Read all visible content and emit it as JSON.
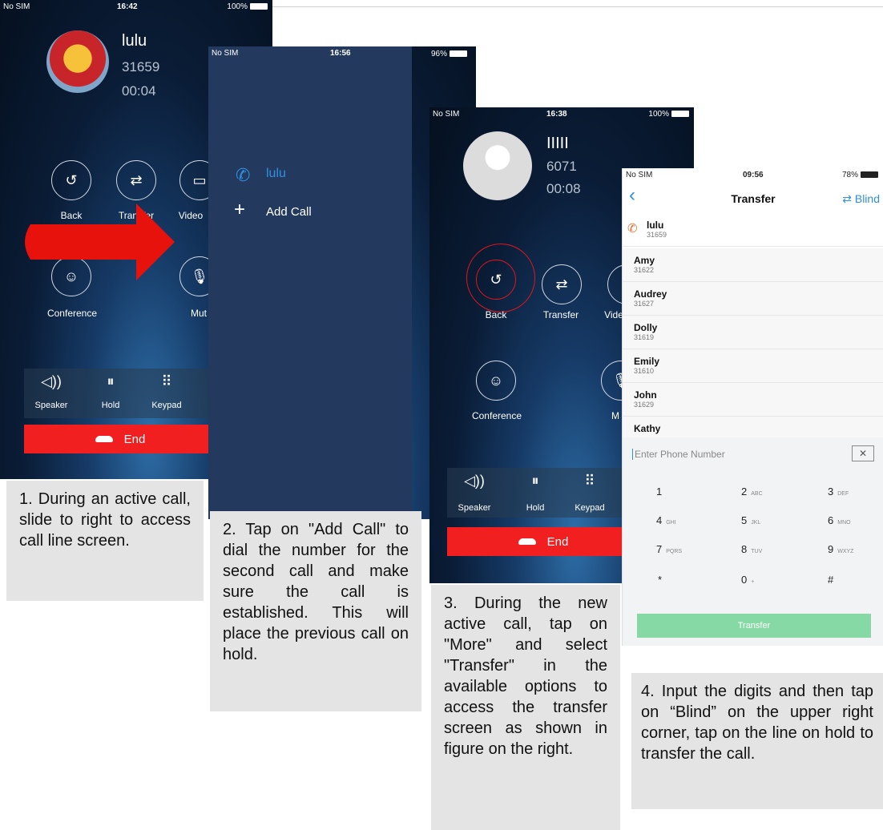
{
  "screen1": {
    "status": {
      "carrier": "No SIM",
      "time": "16:42",
      "battery": "100%"
    },
    "caller": {
      "name": "lulu",
      "number": "31659",
      "duration": "00:04"
    },
    "buttons": [
      "Back",
      "Transfer",
      "Video",
      "Conference",
      "Mut"
    ],
    "bottom": {
      "speaker": "Speaker",
      "hold": "Hold",
      "keypad": "Keypad"
    },
    "end": "End"
  },
  "caption1": "1. During an active call, slide to right to access call line screen.",
  "screen2": {
    "status": {
      "carrier": "No SIM",
      "time": "16:56",
      "battery": "96%"
    },
    "line": "lulu",
    "add_call": "Add Call"
  },
  "caption2": "2. Tap on \"Add Call\" to dial the number for the second call and make sure the call is established. This will place the previous call on hold.",
  "screen3": {
    "status": {
      "carrier": "No SIM",
      "time": "16:38",
      "battery": "100%"
    },
    "caller": {
      "name": "IIIII",
      "number": "6071",
      "duration": "00:08"
    },
    "buttons": [
      "Back",
      "Transfer",
      "Vide",
      "Conference",
      "M"
    ],
    "bottom": {
      "speaker": "Speaker",
      "hold": "Hold",
      "keypad": "Keypad"
    },
    "end": "End"
  },
  "caption3": "3. During the new active call, tap on \"More\" and select \"Transfer\" in the available options to access the transfer screen as shown in figure on the right.",
  "screen4": {
    "status": {
      "carrier": "No SIM",
      "time": "09:56",
      "battery": "78%"
    },
    "title": "Transfer",
    "blind": "Blind",
    "held": {
      "name": "lulu",
      "number": "31659"
    },
    "contacts": [
      {
        "name": "Amy",
        "number": "31622"
      },
      {
        "name": "Audrey",
        "number": "31627"
      },
      {
        "name": "Dolly",
        "number": "31619"
      },
      {
        "name": "Emily",
        "number": "31610"
      },
      {
        "name": "John",
        "number": "31629"
      },
      {
        "name": "Kathy",
        "number": ""
      }
    ],
    "input_placeholder": "Enter Phone Number",
    "keys": [
      {
        "d": "1",
        "l": ""
      },
      {
        "d": "2",
        "l": "ABC"
      },
      {
        "d": "3",
        "l": "DEF"
      },
      {
        "d": "4",
        "l": "GHI"
      },
      {
        "d": "5",
        "l": "JKL"
      },
      {
        "d": "6",
        "l": "MNO"
      },
      {
        "d": "7",
        "l": "PQRS"
      },
      {
        "d": "8",
        "l": "TUV"
      },
      {
        "d": "9",
        "l": "WXYZ"
      },
      {
        "d": "*",
        "l": ""
      },
      {
        "d": "0",
        "l": "+"
      },
      {
        "d": "#",
        "l": ""
      }
    ],
    "transfer_button": "Transfer"
  },
  "caption4": "4. Input the digits and then tap on “Blind” on the upper right corner, tap on the line on hold to transfer the call.",
  "colors": {
    "end_red": "#f11f1f",
    "accent_blue": "#2f8fe0",
    "transfer_green": "#86d9a4",
    "arrow_red": "#e8120c"
  }
}
